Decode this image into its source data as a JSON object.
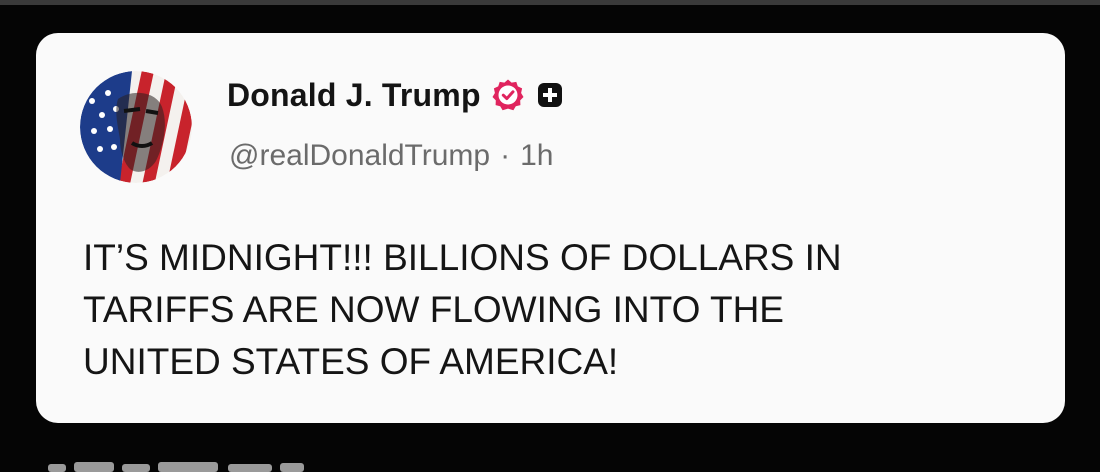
{
  "post": {
    "author": {
      "display_name": "Donald J. Trump",
      "handle": "@realDonaldTrump",
      "verified_icon": "verified-badge-icon",
      "verified_color": "#e0245e",
      "badge_icon": "plus-badge-icon"
    },
    "separator": "·",
    "timestamp": "1h",
    "text_lines": [
      "IT’S MIDNIGHT!!! BILLIONS OF DOLLARS IN",
      "TARIFFS ARE NOW FLOWING INTO THE",
      "UNITED STATES OF AMERICA!"
    ]
  }
}
